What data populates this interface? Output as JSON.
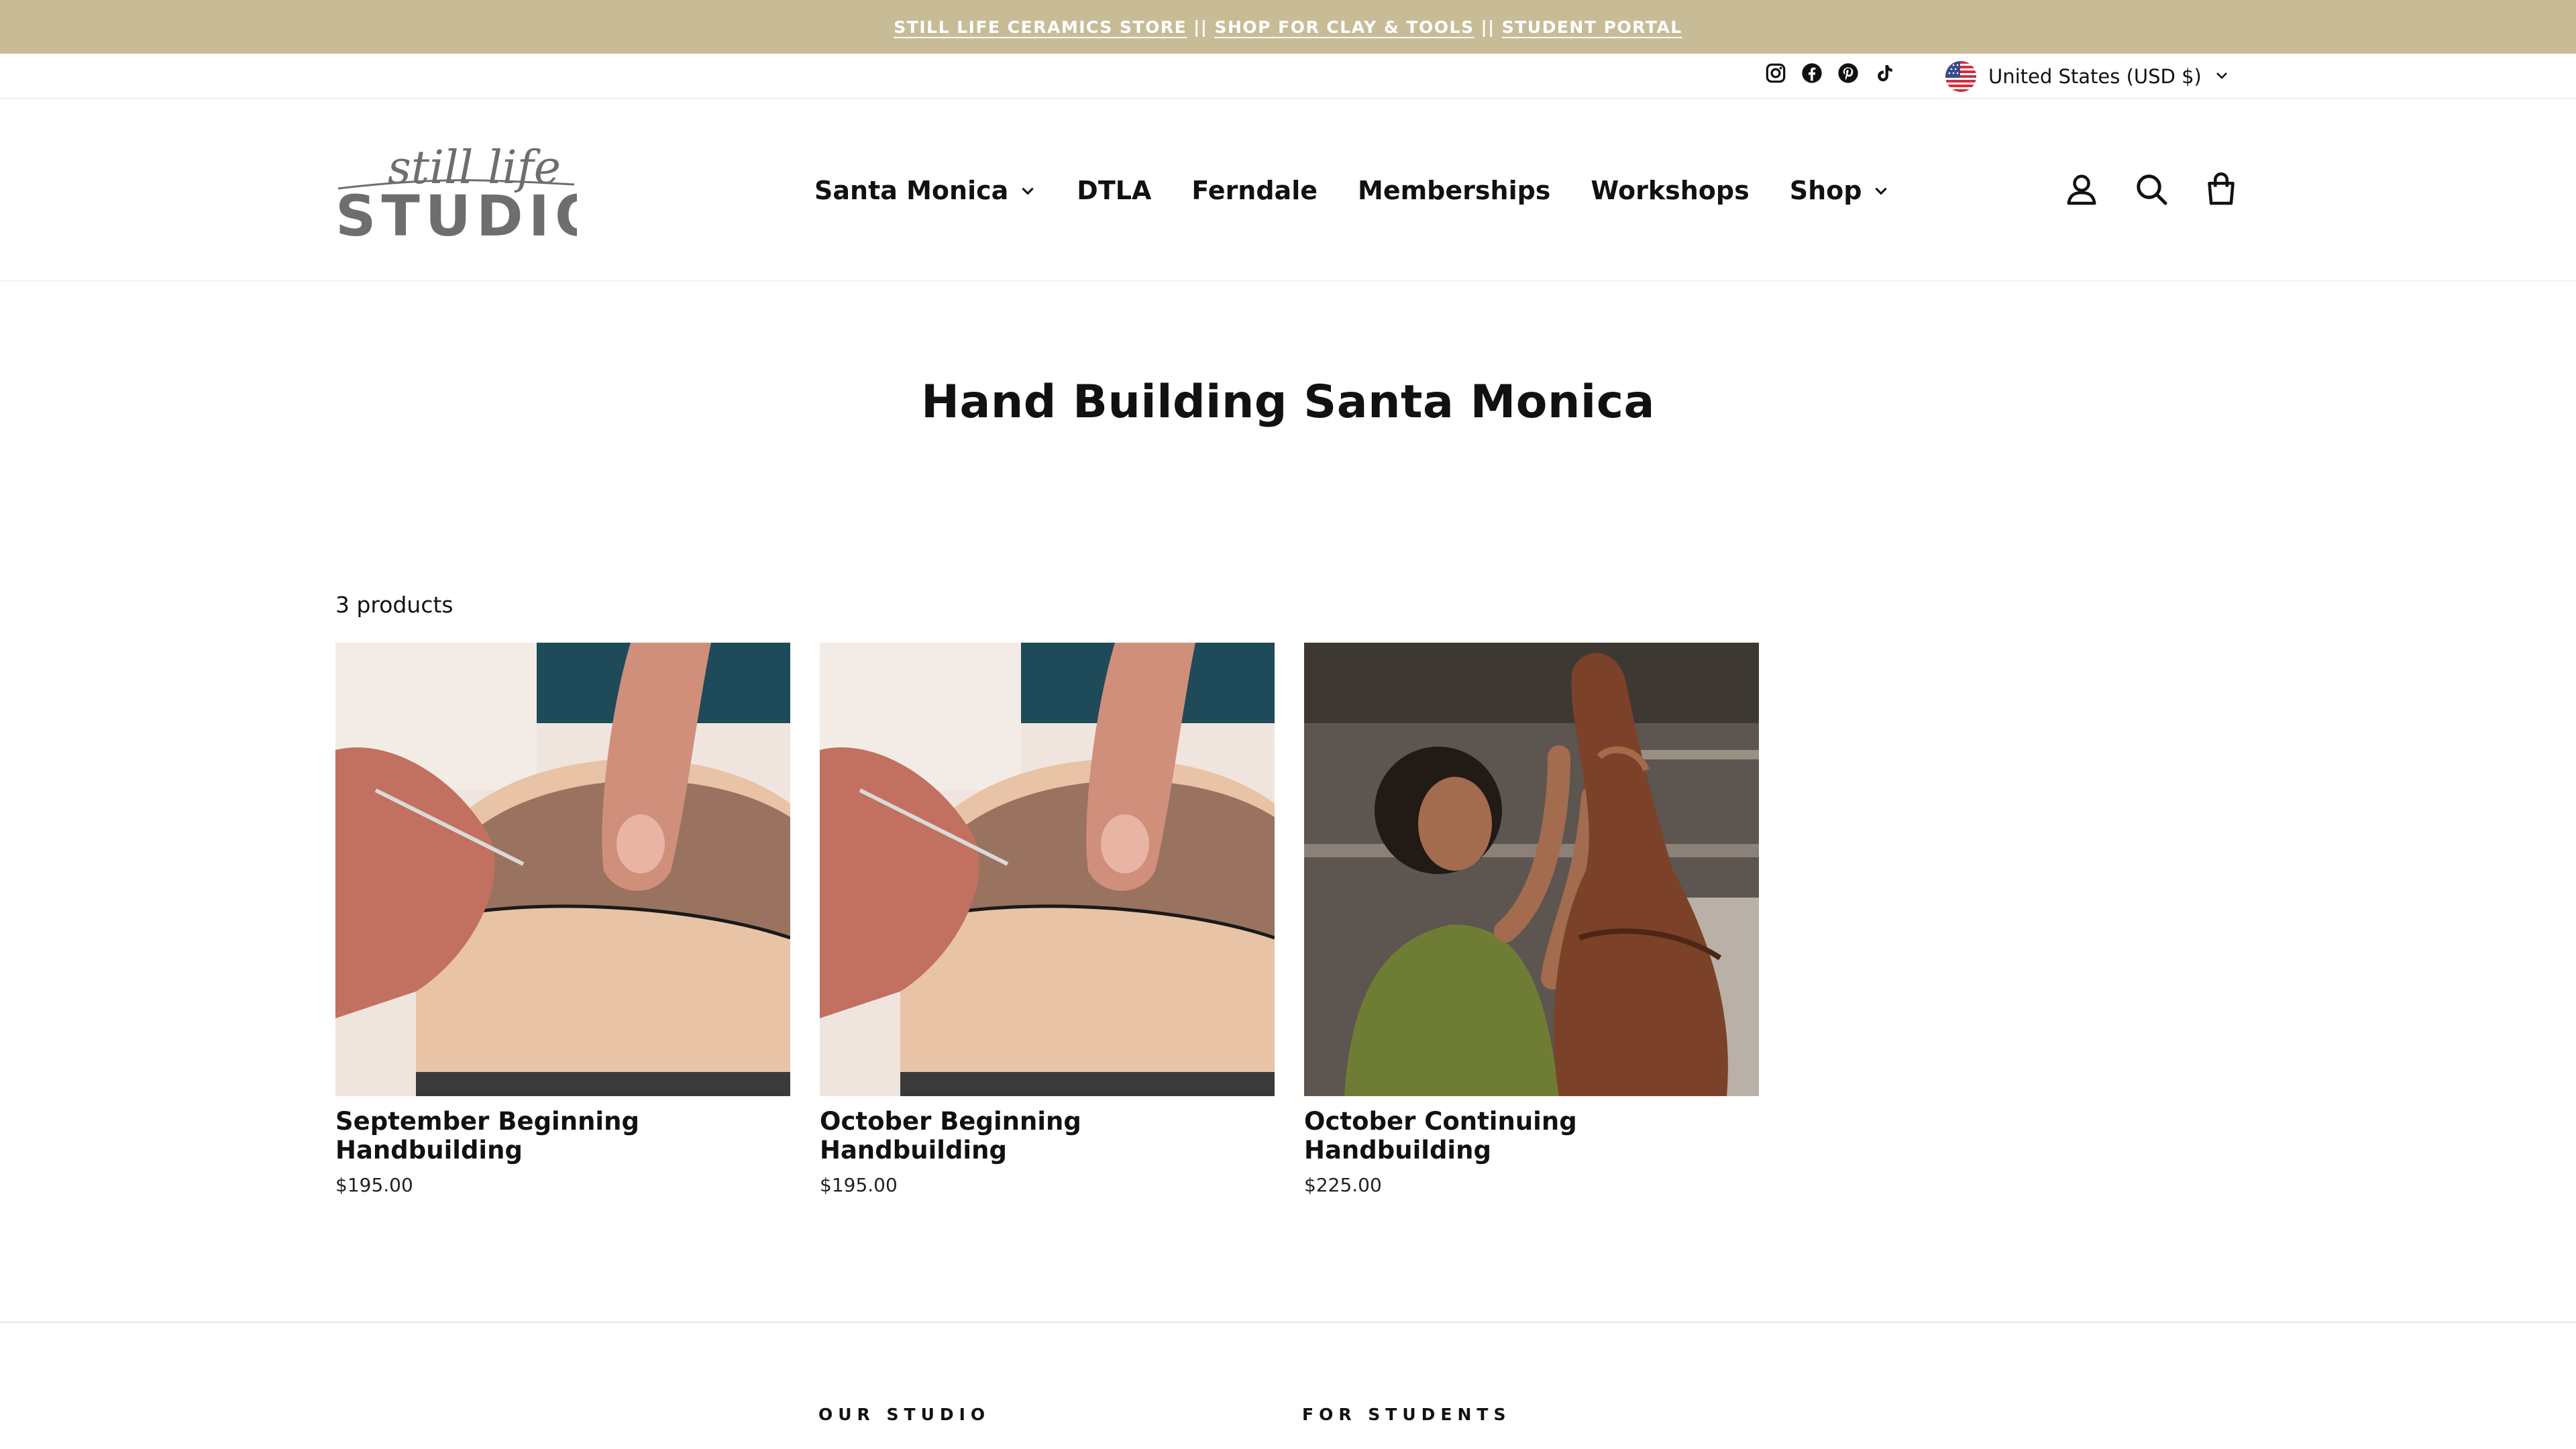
{
  "announcement": {
    "link1": "STILL LIFE CERAMICS STORE",
    "sep1": "||",
    "link2": "SHOP FOR CLAY & TOOLS",
    "sep2": "||",
    "link3": "STUDENT PORTAL"
  },
  "utility": {
    "socials": [
      "instagram-icon",
      "facebook-icon",
      "pinterest-icon",
      "tiktok-icon"
    ],
    "currency": "United States (USD $)"
  },
  "header": {
    "logo_script": "still life",
    "logo_word": "STUDIO",
    "nav": [
      {
        "label": "Santa Monica",
        "dropdown": true
      },
      {
        "label": "DTLA",
        "dropdown": false
      },
      {
        "label": "Ferndale",
        "dropdown": false
      },
      {
        "label": "Memberships",
        "dropdown": false
      },
      {
        "label": "Workshops",
        "dropdown": false
      },
      {
        "label": "Shop",
        "dropdown": true
      }
    ],
    "icons": [
      "account-icon",
      "search-icon",
      "cart-icon"
    ]
  },
  "collection": {
    "title": "Hand Building Santa Monica",
    "count": "3 products"
  },
  "products": [
    {
      "title": "September Beginning Handbuilding",
      "price": "$195.00"
    },
    {
      "title": "October Beginning Handbuilding",
      "price": "$195.00"
    },
    {
      "title": "October Continuing Handbuilding",
      "price": "$225.00"
    }
  ],
  "footer": {
    "col1": "OUR STUDIO",
    "col2": "FOR STUDENTS"
  },
  "colors": {
    "announcement_bg": "#c8bc97",
    "text": "#111111",
    "logo": "#6e6e6e"
  }
}
